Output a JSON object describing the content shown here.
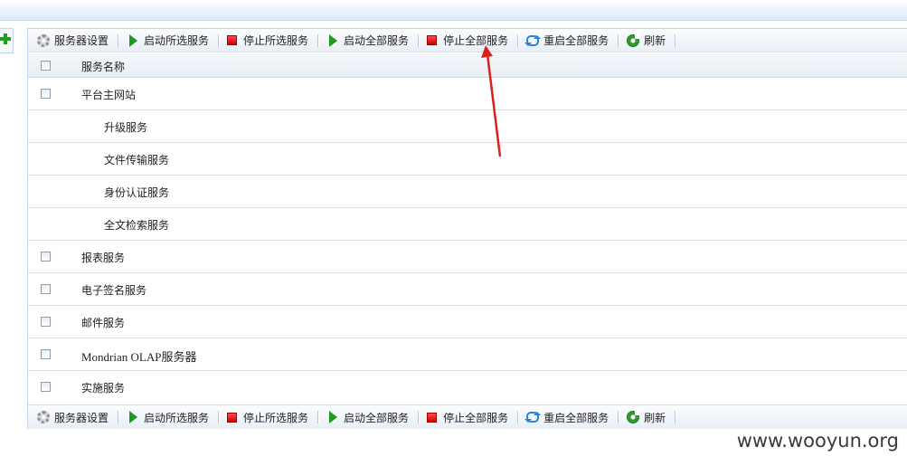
{
  "toolbar": {
    "items": [
      {
        "label": "服务器设置",
        "icon": "gear-icon"
      },
      {
        "label": "启动所选服务",
        "icon": "play-icon"
      },
      {
        "label": "停止所选服务",
        "icon": "stop-icon"
      },
      {
        "label": "启动全部服务",
        "icon": "play-icon"
      },
      {
        "label": "停止全部服务",
        "icon": "stop-icon"
      },
      {
        "label": "重启全部服务",
        "icon": "restart-icon"
      },
      {
        "label": "刷新",
        "icon": "refresh-icon"
      }
    ]
  },
  "table": {
    "header": "服务名称",
    "rows": [
      {
        "label": "平台主网站",
        "checkbox": true
      },
      {
        "label": "升级服务",
        "checkbox": false
      },
      {
        "label": "文件传输服务",
        "checkbox": false
      },
      {
        "label": "身份认证服务",
        "checkbox": false
      },
      {
        "label": "全文检索服务",
        "checkbox": false
      },
      {
        "label": "报表服务",
        "checkbox": true
      },
      {
        "label": "电子签名服务",
        "checkbox": true
      },
      {
        "label": "邮件服务",
        "checkbox": true
      },
      {
        "label": "Mondrian OLAP服务器",
        "checkbox": true
      },
      {
        "label": "实施服务",
        "checkbox": true
      }
    ]
  },
  "colors": {
    "accent_green": "#1d9a1f",
    "stop_red": "#d00000",
    "restart_blue": "#2f82d3",
    "annotation_arrow": "#d9201c"
  },
  "watermark": "www.wooyun.org"
}
